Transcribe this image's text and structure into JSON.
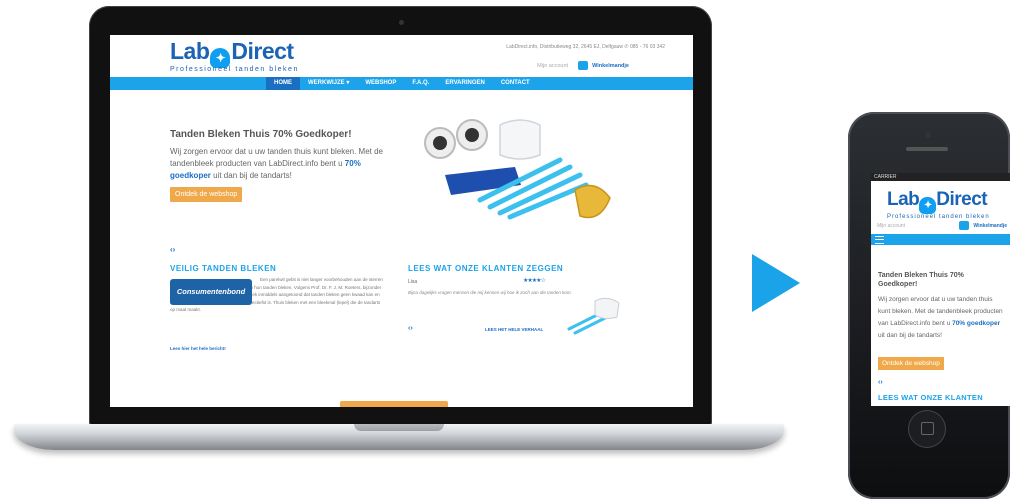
{
  "colors": {
    "accent": "#1da3e9",
    "brand": "#1b6fc2",
    "cta": "#f0a94a"
  },
  "site": {
    "logo_text_left": "Lab",
    "logo_text_right": "Direct",
    "logo_tagline": "Professioneel tanden bleken",
    "contact_line": "LabDirect.info, Distributieweg 32, 2645 EJ, Delfgauw ✆ 085 - 76 03 342",
    "account_link": "Mijn account",
    "cart_label": "Winkelmandje",
    "nav": [
      {
        "label": "HOME"
      },
      {
        "label": "WERKWIJZE ▾"
      },
      {
        "label": "WEBSHOP"
      },
      {
        "label": "F.A.Q."
      },
      {
        "label": "ERVARINGEN"
      },
      {
        "label": "CONTACT"
      }
    ],
    "hero": {
      "title": "Tanden Bleken Thuis 70% Goedkoper!",
      "text_1": "Wij zorgen ervoor dat u uw tanden thuis kunt bleken. Met de tandenbleek producten van LabDirect.info bent u ",
      "text_accent": "70% goedkoper",
      "text_2": " uit dan bij de tandarts!",
      "cta": "Ontdek de webshop"
    },
    "slider_arrows": "‹›",
    "safe_section": {
      "title": "VEILIG TANDEN BLEKEN",
      "badge": "Consumentenbond",
      "text": "Een parelwit gebit is niet langer voorbehouden aan de sterren uit Hollywood. Steeds meer mensen laten hun tanden bleken. Volgens Prof. Dr. F. J. M. Roeters, bijzonder hoogleraar tandheelkunde, heeft onderzoek inmiddels aangetoond dat tanden bleken geen kwaad kan en dat thuis bleken met een bleekmal het effectiefst is. Thuis bleken met een bleekmal (lepel) die de tandarts op maat maakt.",
      "read_more": "Lees hier het hele bericht!"
    },
    "reviews_section": {
      "title": "LEES WAT ONZE KLANTEN ZEGGEN",
      "reviewer": "Lisa",
      "stars": "★★★★☆",
      "rating": 4,
      "text": "Bijna dagelijks vragen mensen die mij kennen wij hoe ik zoch aan die tanden kom.",
      "read_more": "LEES HET HELE VERHAAL"
    }
  },
  "phone": {
    "status": "CARRIER",
    "logo_text_left": "Lab",
    "logo_text_right": "Direct",
    "logo_tagline": "Professioneel tanden bleken",
    "account_link": "Mijn account",
    "cart_label": "Winkelmandje",
    "title": "Tanden Bleken Thuis 70% Goedkoper!",
    "text_1": "Wij zorgen ervoor dat u uw tanden thuis kunt bleken. Met de tandenbleek producten van LabDirect.info bent u ",
    "text_accent": "70% goedkoper",
    "text_2": " uit dan bij de tandarts!",
    "cta": "Ontdek de webshop",
    "arrows": "‹›",
    "section_title": "LEES WAT ONZE KLANTEN"
  }
}
